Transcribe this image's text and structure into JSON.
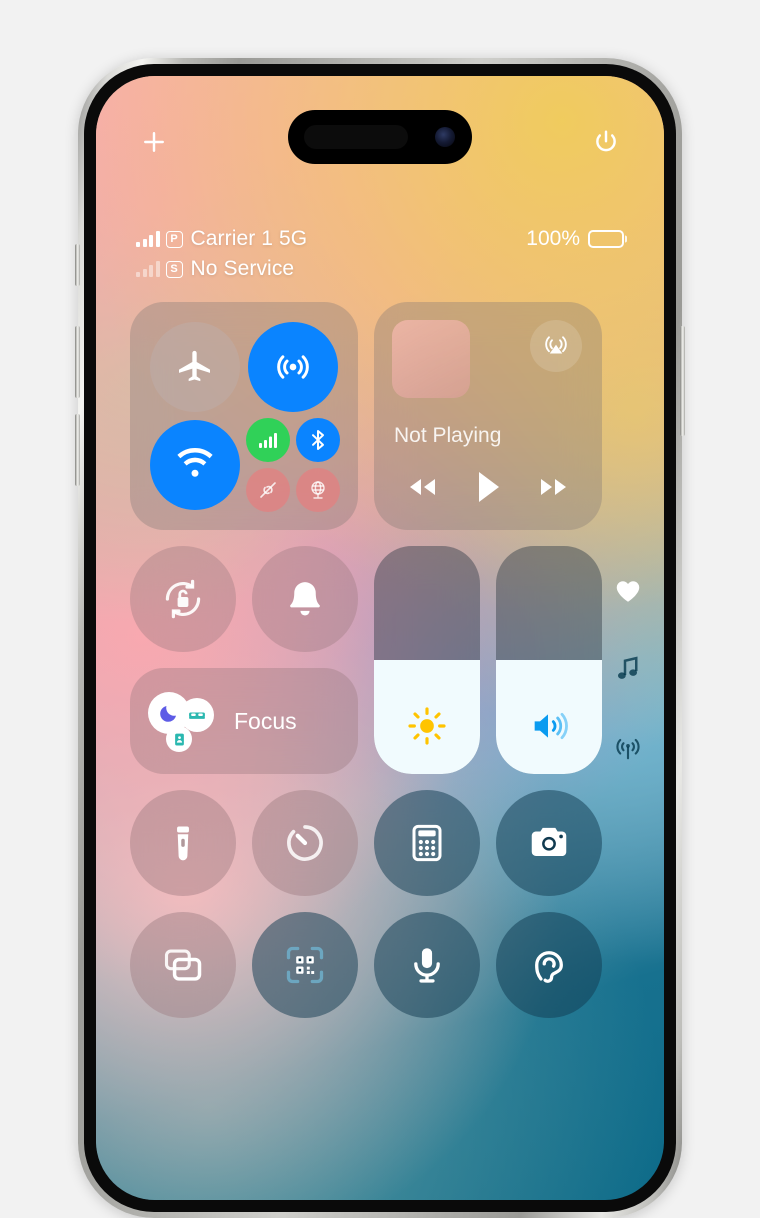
{
  "device": {
    "name": "iphone-control-center"
  },
  "top_controls": {
    "add_icon": "plus-icon",
    "power_icon": "power-icon"
  },
  "status_bar": {
    "line1": {
      "carrier": "Carrier 1 5G",
      "sim_badge": "P",
      "signal_bars": 4
    },
    "line2": {
      "carrier": "No Service",
      "sim_badge": "S",
      "signal_bars": 0
    },
    "battery_percent": "100%",
    "battery_level": 100
  },
  "connectivity": {
    "airplane": {
      "label": "Airplane Mode",
      "state": "off",
      "icon": "airplane-icon"
    },
    "airdrop": {
      "label": "AirDrop",
      "state": "on",
      "icon": "airdrop-icon",
      "color": "#0a84ff"
    },
    "wifi": {
      "label": "Wi-Fi",
      "state": "on",
      "icon": "wifi-icon",
      "color": "#0a84ff"
    },
    "cellular": {
      "label": "Cellular Data",
      "state": "on",
      "icon": "cellular-icon",
      "color": "#30d158"
    },
    "bluetooth": {
      "label": "Bluetooth",
      "state": "on",
      "icon": "bluetooth-icon",
      "color": "#0a84ff"
    },
    "hotspot": {
      "label": "Personal Hotspot",
      "state": "off",
      "icon": "hotspot-icon"
    },
    "vpn": {
      "label": "VPN",
      "state": "off",
      "icon": "vpn-globe-icon"
    }
  },
  "media": {
    "title": "Not Playing",
    "airplay_icon": "airplay-icon",
    "rewind_icon": "rewind-icon",
    "play_icon": "play-icon",
    "forward_icon": "fast-forward-icon"
  },
  "quick_toggles": {
    "rotation_lock": {
      "label": "Rotation Lock",
      "state": "off",
      "icon": "rotation-lock-icon"
    },
    "silent_mode": {
      "label": "Silent Mode",
      "state": "off",
      "icon": "bell-icon"
    }
  },
  "focus": {
    "label": "Focus",
    "icons": [
      "moon-icon",
      "bed-icon",
      "work-icon"
    ],
    "moon_color": "#5e5ce6",
    "bed_color": "#2bb8b0",
    "work_color": "#2bb8b0"
  },
  "sliders": {
    "brightness": {
      "label": "Brightness",
      "value": 50,
      "icon": "sun-icon",
      "icon_color": "#ffc400"
    },
    "volume": {
      "label": "Volume",
      "value": 50,
      "icon": "speaker-icon",
      "icon_color": "#0a9bf0"
    }
  },
  "apps": [
    {
      "label": "Flashlight",
      "icon": "flashlight-icon",
      "tone": "warm"
    },
    {
      "label": "Timer",
      "icon": "timer-icon",
      "tone": "warm"
    },
    {
      "label": "Calculator",
      "icon": "calculator-icon",
      "tone": "cool"
    },
    {
      "label": "Camera",
      "icon": "camera-icon",
      "tone": "cool"
    },
    {
      "label": "Screen Mirroring",
      "icon": "screen-mirroring-icon",
      "tone": "warm"
    },
    {
      "label": "Code Scanner",
      "icon": "qr-code-icon",
      "tone": "cool"
    },
    {
      "label": "Voice Memo",
      "icon": "microphone-icon",
      "tone": "cool"
    },
    {
      "label": "Hearing",
      "icon": "hearing-ear-icon",
      "tone": "cool"
    }
  ],
  "page_rail": [
    {
      "icon": "heart-icon",
      "label": "Favorites",
      "active": true
    },
    {
      "icon": "music-note-icon",
      "label": "Media",
      "active": false
    },
    {
      "icon": "broadcast-icon",
      "label": "Connectivity",
      "active": false
    }
  ]
}
